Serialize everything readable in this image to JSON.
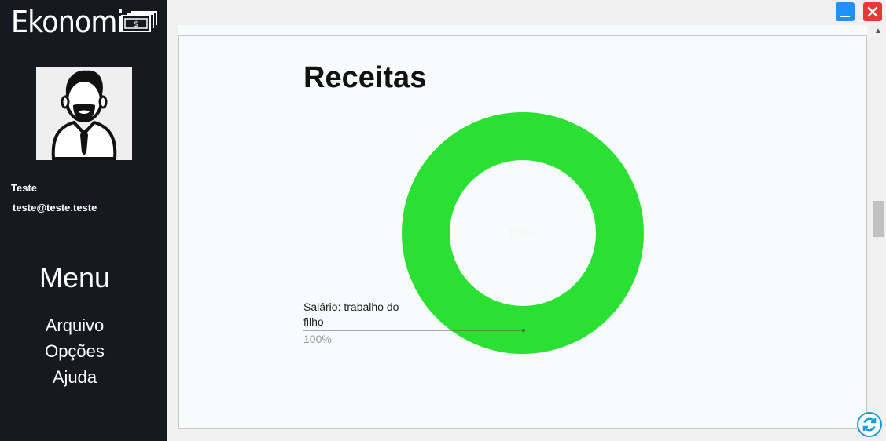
{
  "app": {
    "brand": "Ekonomi"
  },
  "user": {
    "name": "Teste",
    "email": "teste@teste.teste"
  },
  "menu": {
    "title": "Menu",
    "items": [
      {
        "label": "Arquivo"
      },
      {
        "label": "Opções"
      },
      {
        "label": "Ajuda"
      }
    ]
  },
  "page": {
    "title": "Receitas"
  },
  "chart_data": {
    "type": "pie",
    "title": "Receitas",
    "donut": true,
    "slices": [
      {
        "label": "Salário: trabalho do filho",
        "value": 100,
        "percent": "100%",
        "color": "#2ae032"
      }
    ],
    "center_text": "100%"
  },
  "colors": {
    "sidebar": "#16191f",
    "accent": "#2ae032",
    "minimize": "#1e90ff",
    "close": "#e53935"
  },
  "icons": [
    "money-icon",
    "avatar-icon",
    "minimize-icon",
    "close-icon",
    "refresh-icon",
    "scroll-up-icon"
  ]
}
